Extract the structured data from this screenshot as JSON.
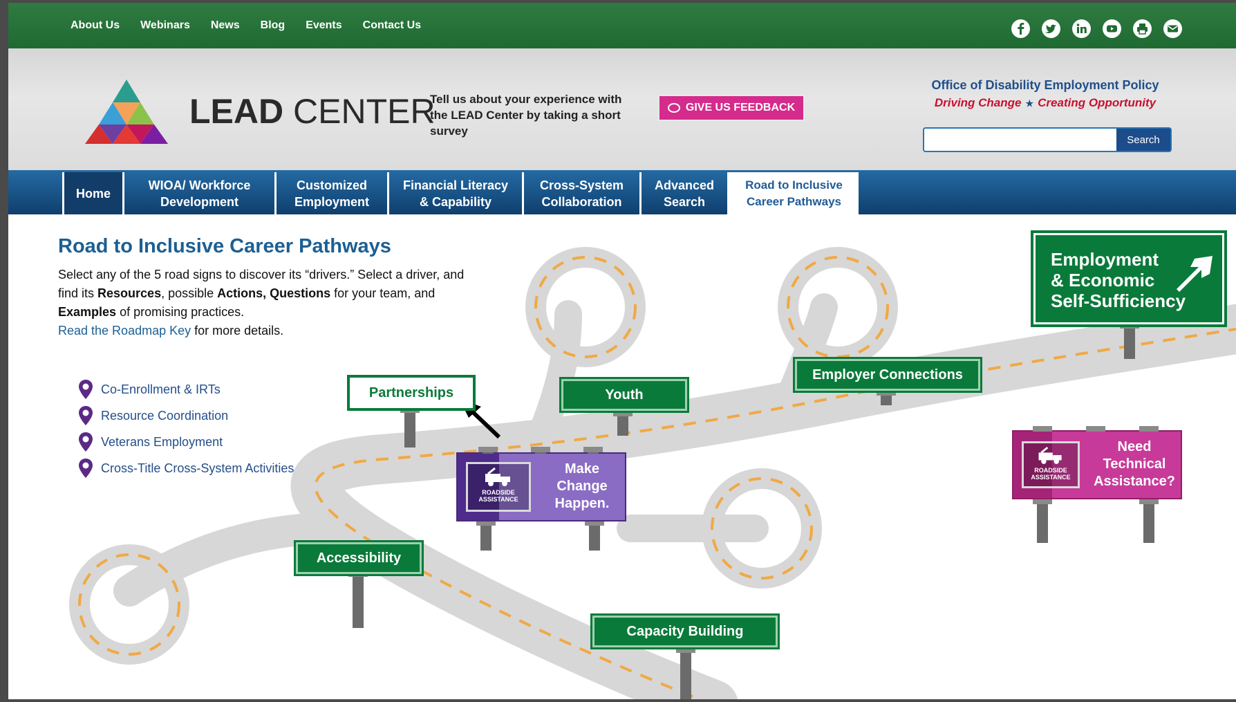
{
  "topbar": {
    "links": [
      "About Us",
      "Webinars",
      "News",
      "Blog",
      "Events",
      "Contact Us"
    ],
    "social_icons": [
      "facebook-icon",
      "twitter-icon",
      "linkedin-icon",
      "youtube-icon",
      "print-icon",
      "email-icon"
    ]
  },
  "header": {
    "logo_bold": "LEAD",
    "logo_light": "CENTER",
    "survey_text": "Tell us about your experience with the LEAD Center by taking a short survey",
    "feedback_label": "GIVE US FEEDBACK",
    "odep_title": "Office of Disability Employment Policy",
    "odep_tagline_left": "Driving Change",
    "odep_tagline_right": "Creating Opportunity",
    "search_value": "",
    "search_button": "Search"
  },
  "nav": {
    "tabs": [
      {
        "line1": "Home",
        "line2": ""
      },
      {
        "line1": "WIOA/ Workforce",
        "line2": "Development"
      },
      {
        "line1": "Customized",
        "line2": "Employment"
      },
      {
        "line1": "Financial Literacy",
        "line2": "& Capability"
      },
      {
        "line1": "Cross-System",
        "line2": "Collaboration"
      },
      {
        "line1": "Advanced",
        "line2": "Search"
      },
      {
        "line1": "Road to Inclusive",
        "line2": "Career Pathways"
      }
    ],
    "active_index": 6
  },
  "content": {
    "title": "Road to Inclusive Career Pathways",
    "intro_1": "Select any of the 5 road signs to discover its “drivers.” Select a driver, and find its ",
    "intro_resources": "Resources",
    "intro_2": ", possible ",
    "intro_actions": "Actions, Questions",
    "intro_3": " for your team, and ",
    "intro_examples": "Examples",
    "intro_4": " of promising practices.",
    "roadmap_link": "Read the Roadmap Key",
    "roadmap_suffix": " for more details.",
    "legend": [
      "Co-Enrollment & IRTs",
      "Resource Coordination",
      "Veterans Employment",
      "Cross-Title Cross-System Activities"
    ]
  },
  "map": {
    "signs": {
      "partnerships": "Partnerships",
      "youth": "Youth",
      "employer": "Employer Connections",
      "accessibility": "Accessibility",
      "capacity": "Capacity Building"
    },
    "destination": [
      "Employment",
      "& Economic",
      "Self-Sufficiency"
    ],
    "billboard_purple": [
      "Make",
      "Change",
      "Happen."
    ],
    "billboard_pink": [
      "Need",
      "Technical",
      "Assistance?"
    ],
    "roadside_badge": [
      "ROADSIDE",
      "ASSISTANCE"
    ]
  },
  "colors": {
    "topbar_green": "#1f6a32",
    "nav_blue": "#0f3f6e",
    "sign_green": "#0a7a3a",
    "feedback_pink": "#d42b8c",
    "billboard_purple": "#7a5cb0",
    "billboard_pink": "#c12d8f",
    "road_gray": "#d7d7d7",
    "road_dash": "#f0a945"
  }
}
